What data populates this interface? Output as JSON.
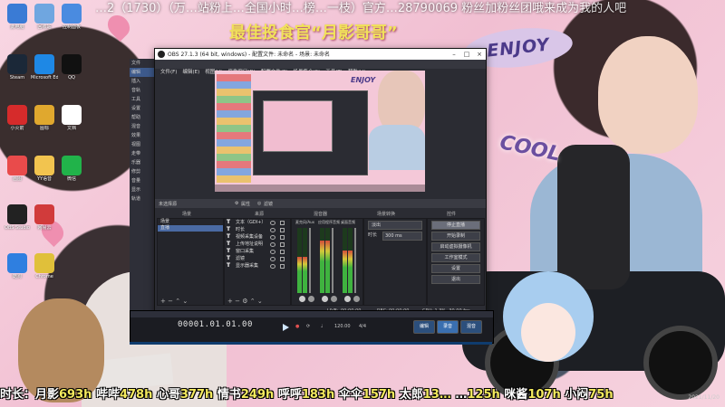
{
  "banner": {
    "top_text": "…2（1730）（万…站粉上…全国小时…榜…一枝）官方…28790069 粉丝加粉丝团哦来成为我的人吧",
    "title": "最佳投食官“月影哥哥”"
  },
  "stickers": {
    "enjoy": "ENJOY",
    "cool": "COOL"
  },
  "desktop_icons": [
    {
      "label": "此电脑",
      "color": "#3a7bd5"
    },
    {
      "label": "回收站",
      "color": "#6fa6e0"
    },
    {
      "label": "控制面板",
      "color": "#4a8be0"
    },
    {
      "label": "Steam",
      "color": "#1b2838"
    },
    {
      "label": "Microsoft Edge",
      "color": "#1e88e5"
    },
    {
      "label": "QQ",
      "color": "#111111"
    },
    {
      "label": "小火箭",
      "color": "#d62b2b"
    },
    {
      "label": "图标",
      "color": "#e0a82e"
    },
    {
      "label": "文档",
      "color": "#ffffff"
    },
    {
      "label": "画图",
      "color": "#e94b4b"
    },
    {
      "label": "YY语音",
      "color": "#f2c44f"
    },
    {
      "label": "微信",
      "color": "#21b34a"
    },
    {
      "label": "OBS Studio",
      "color": "#222222"
    },
    {
      "label": "网易云",
      "color": "#d13b3b"
    },
    {
      "label": "酷狗",
      "color": "#2f7fe0"
    },
    {
      "label": "Chrome",
      "color": "#e0c03a"
    }
  ],
  "side_strip": [
    "文件",
    "编辑",
    "插入",
    "音轨",
    "工具",
    "设置",
    "帮助",
    "混音",
    "效果",
    "视图",
    "走带",
    "乐器",
    "修剪",
    "音量",
    "显示",
    "轨道"
  ],
  "obs": {
    "title": "OBS 27.1.3 (64 bit, windows) - 配置文件: 未命名 - 场景: 未命名",
    "menu": [
      "文件(F)",
      "编辑(E)",
      "视图(V)",
      "停靠窗口(D)",
      "配置文件(P)",
      "场景集合(S)",
      "工具(T)",
      "帮助(H)"
    ],
    "source_bar": {
      "selected": "未选择源",
      "properties": "属性",
      "filters": "滤镜"
    },
    "docks": {
      "scenes": "场景",
      "sources": "来源",
      "mixer": "混音器",
      "transitions": "场景转换",
      "controls": "控件"
    },
    "scenes": [
      "场景",
      "直播"
    ],
    "sources": [
      "文本（GDI+）",
      "时长",
      "视频采集设备",
      "上传地址说明",
      "窗口采集",
      "滤镜",
      "显示器采集"
    ],
    "mixer_tracks": [
      {
        "name": "麦克风/Aux",
        "level": 0.55
      },
      {
        "name": "应用程序音频",
        "level": 0.8
      },
      {
        "name": "桌面音频",
        "level": 0.65
      }
    ],
    "transition": {
      "type": "淡出",
      "duration_label": "时长",
      "duration_value": "300 ms"
    },
    "controls": [
      "停止直播",
      "开始录制",
      "启动虚拟摄像机",
      "工作室模式",
      "设置",
      "退出"
    ],
    "status": {
      "live_label": "LIVE:",
      "live_time": "00:00:00",
      "rec_label": "REC:",
      "rec_time": "00:00:00",
      "cpu": "CPU: 1.3%, 30.00 fps"
    }
  },
  "daw": {
    "time": "00001.01.01.00",
    "bpm": "120.00",
    "meter": "4/4",
    "btn_record": "编辑",
    "btn_play": "录音",
    "btn_mix": "混音"
  },
  "ticker_items": [
    {
      "name": "时长：月影",
      "value": "693h"
    },
    {
      "name": "哔哔",
      "value": "478h"
    },
    {
      "name": "心哥",
      "value": "377h"
    },
    {
      "name": "情书",
      "value": "249h"
    },
    {
      "name": "呼呼",
      "value": "183h"
    },
    {
      "name": "伞伞",
      "value": "157h"
    },
    {
      "name": "太郎",
      "value": "13…"
    },
    {
      "name": "…",
      "value": "125h"
    },
    {
      "name": "咪酱",
      "value": "107h"
    },
    {
      "name": "小闷",
      "value": "75h"
    }
  ],
  "timestamp": "2021/11/20"
}
